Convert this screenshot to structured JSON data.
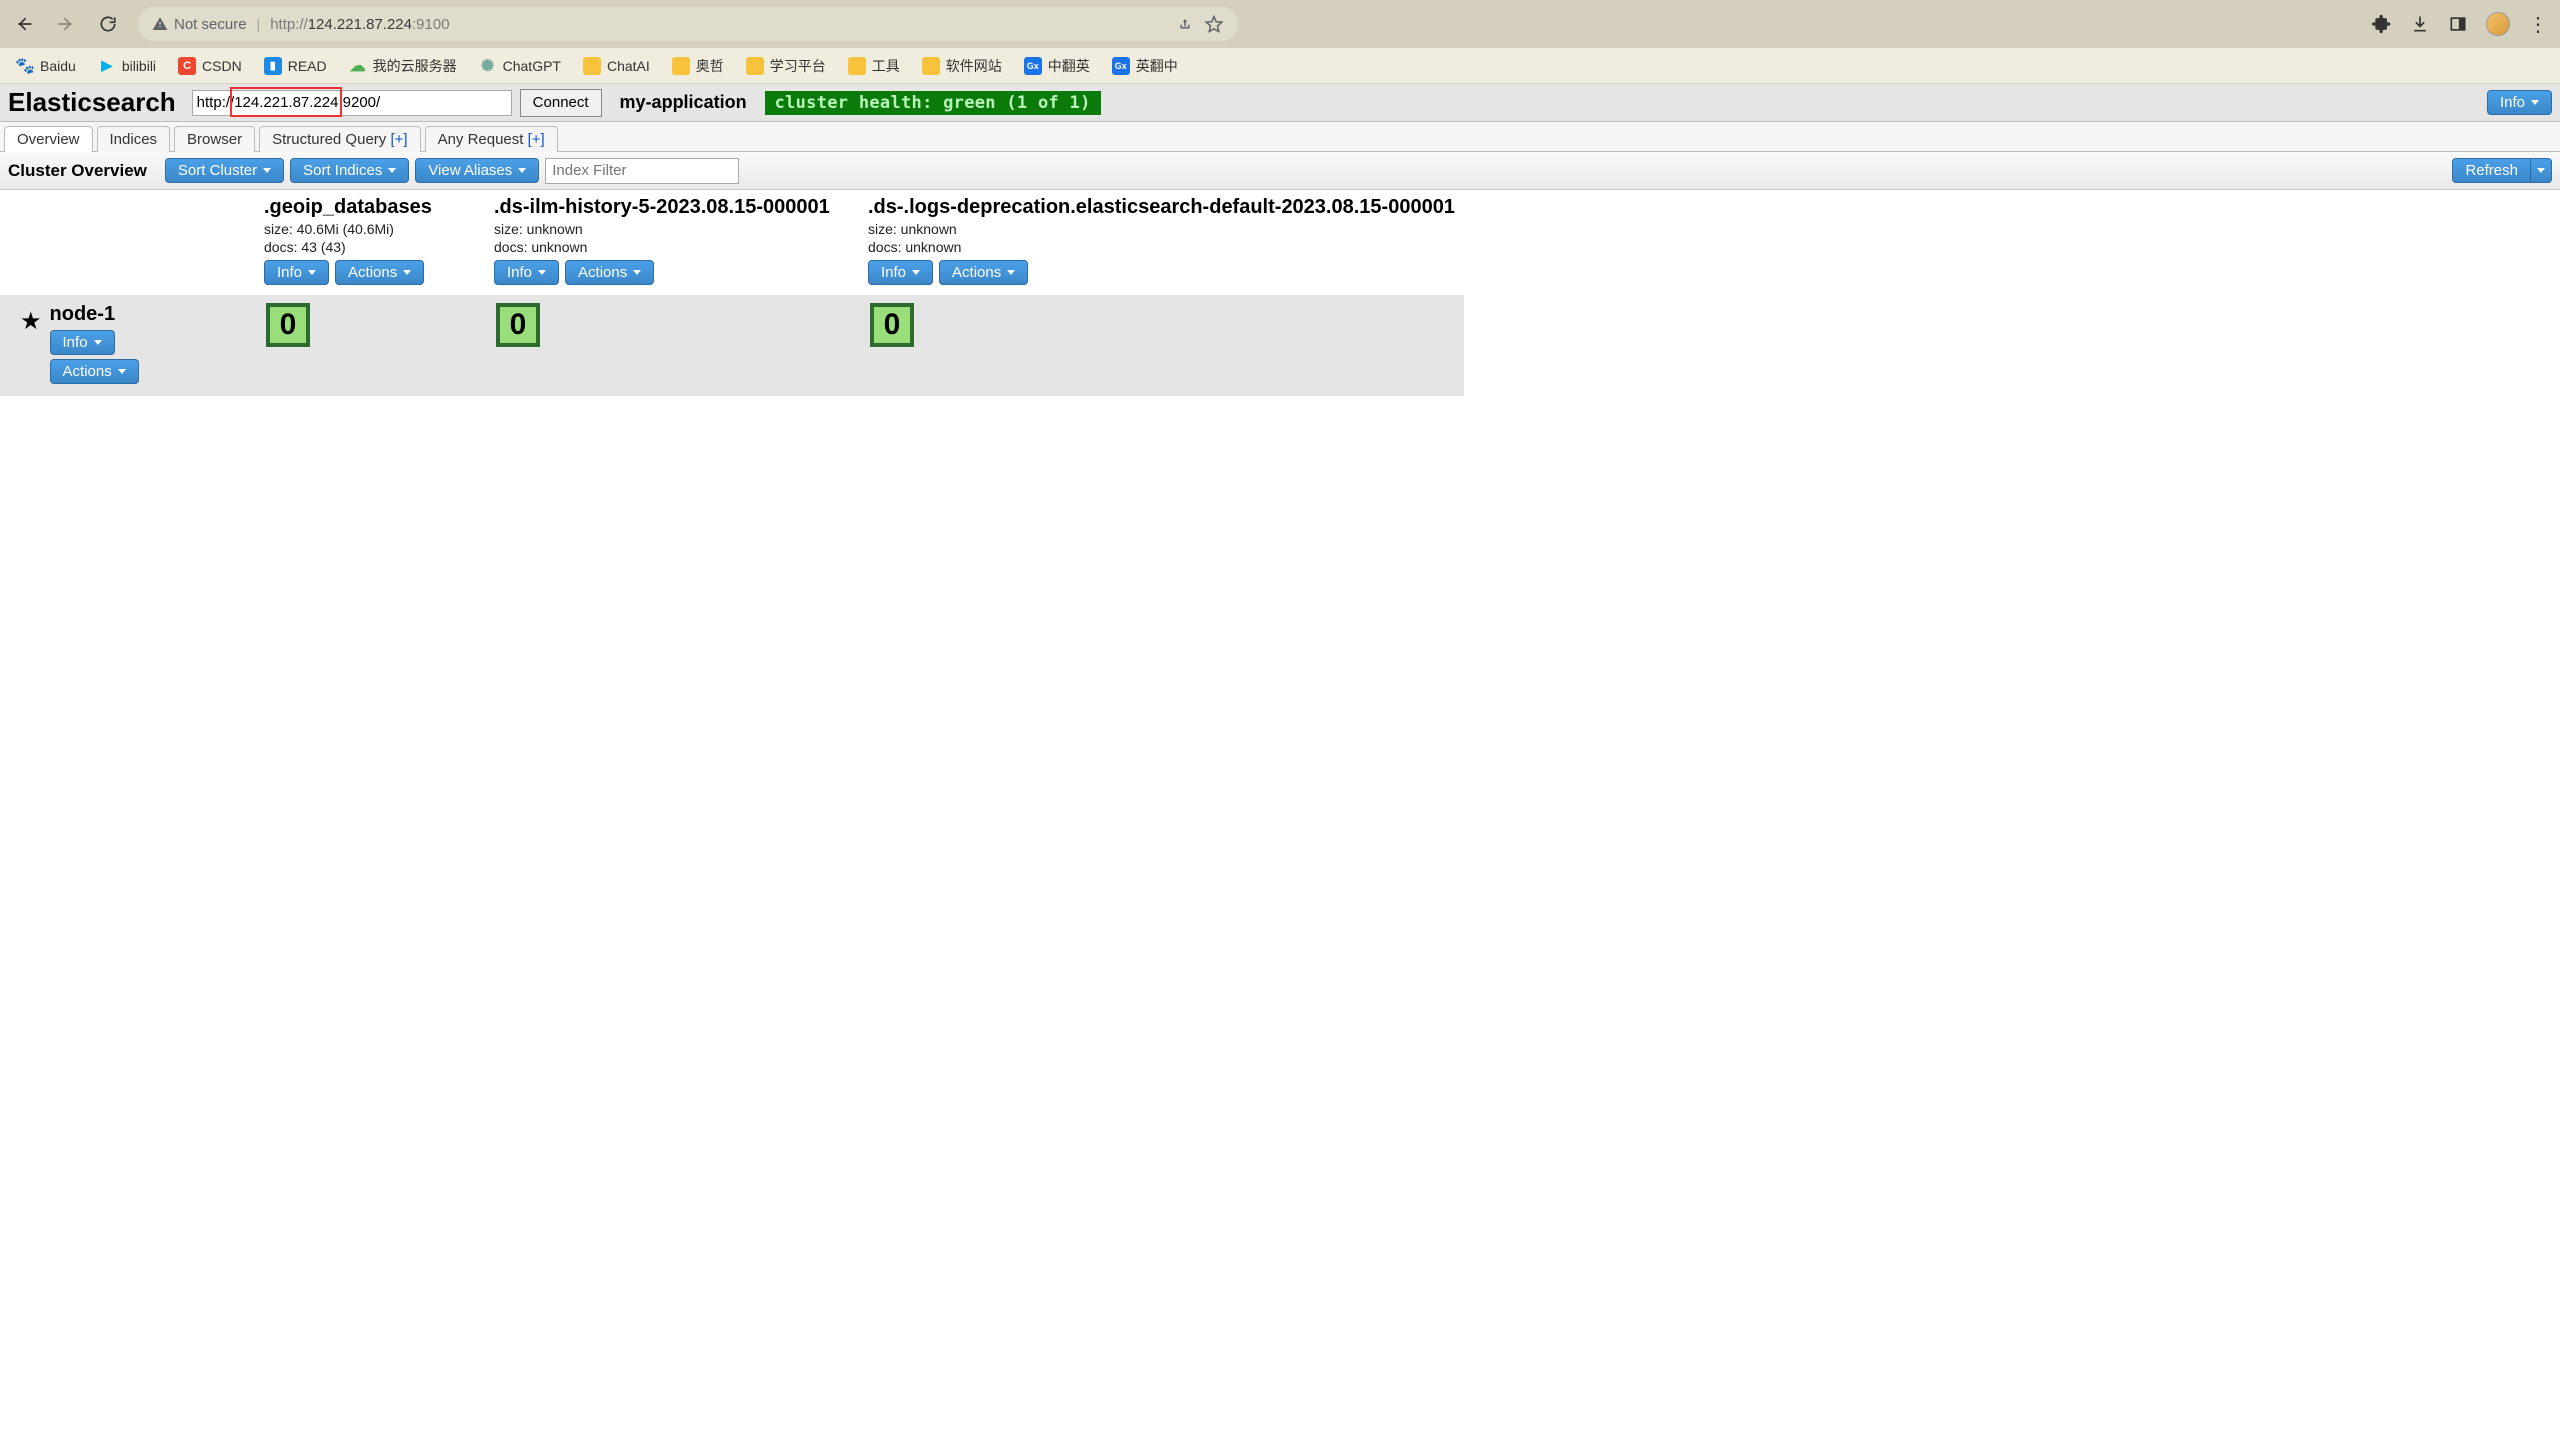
{
  "browser": {
    "not_secure": "Not secure",
    "url_prefix": "http://",
    "url_host": "124.221.87.224",
    "url_port": ":9100"
  },
  "bookmarks": {
    "baidu": "Baidu",
    "bilibili": "bilibili",
    "csdn": "CSDN",
    "read": "READ",
    "myserver": "我的云服务器",
    "chatgpt": "ChatGPT",
    "chatai": "ChatAI",
    "aozhe": "奥哲",
    "study": "学习平台",
    "tools": "工具",
    "soft": "软件网站",
    "zh2en": "中翻英",
    "en2zh": "英翻中"
  },
  "head": {
    "title": "Elasticsearch",
    "connect_url": "http://124.221.87.224:9200/",
    "connect_label": "Connect",
    "app_name": "my-application",
    "health": "cluster health: green (1 of 1)",
    "info_label": "Info"
  },
  "tabs": {
    "overview": "Overview",
    "indices": "Indices",
    "browser": "Browser",
    "structured": "Structured Query",
    "any": "Any Request",
    "plus": "[+]"
  },
  "subbar": {
    "title": "Cluster Overview",
    "sort_cluster": "Sort Cluster",
    "sort_indices": "Sort Indices",
    "view_aliases": "View Aliases",
    "filter_placeholder": "Index Filter",
    "refresh": "Refresh"
  },
  "buttons": {
    "info": "Info",
    "actions": "Actions"
  },
  "indices": [
    {
      "name": ".geoip_databases",
      "size": "size: 40.6Mi (40.6Mi)",
      "docs": "docs: 43 (43)"
    },
    {
      "name": ".ds-ilm-history-5-2023.08.15-000001",
      "size": "size: unknown",
      "docs": "docs: unknown"
    },
    {
      "name": ".ds-.logs-deprecation.elasticsearch-default-2023.08.15-000001",
      "size": "size: unknown",
      "docs": "docs: unknown"
    }
  ],
  "node": {
    "name": "node-1",
    "shard": "0"
  }
}
